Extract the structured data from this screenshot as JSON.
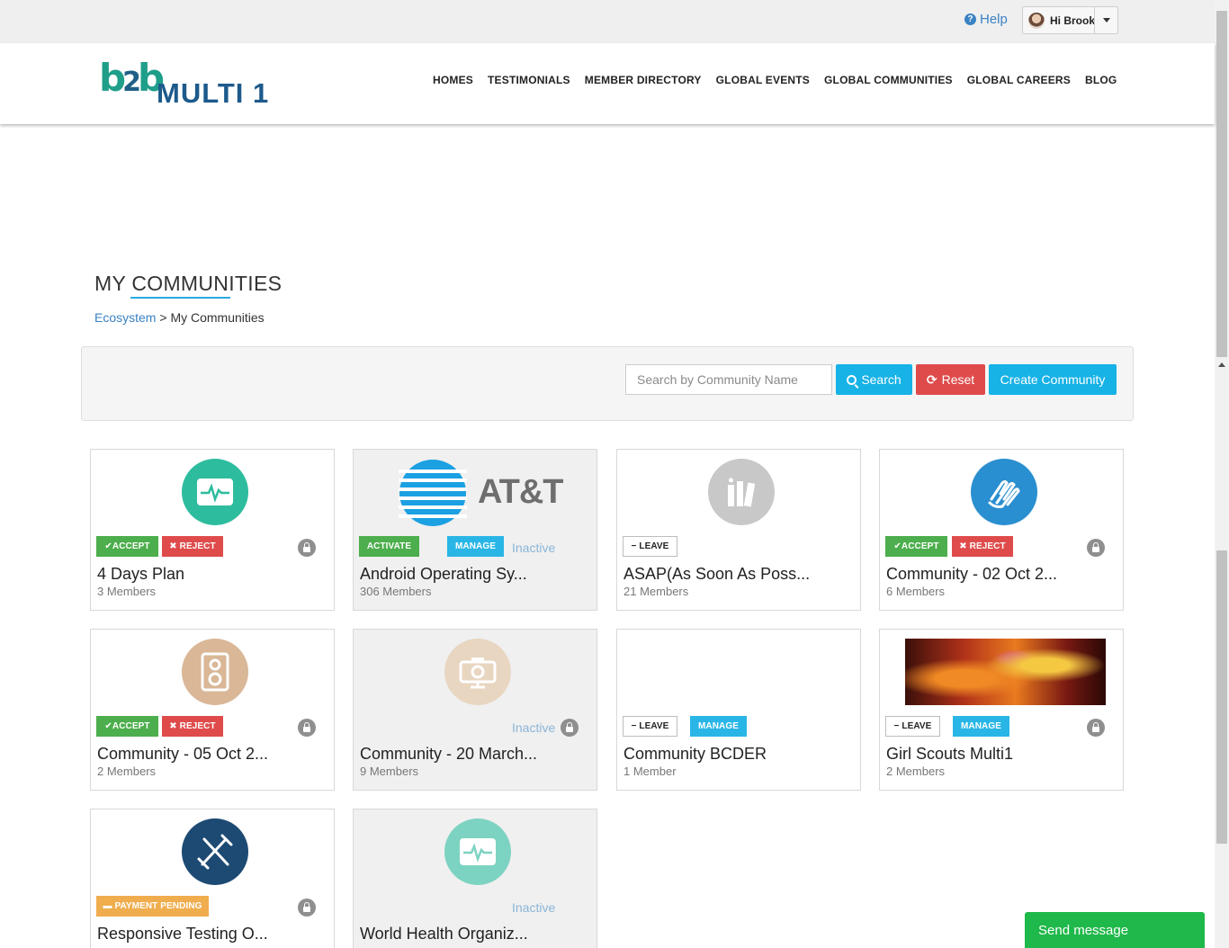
{
  "topbar": {
    "help_label": "Help",
    "user_greeting": "Hi Brook"
  },
  "header": {
    "logo_mark": "b2b",
    "logo_text": "MULTI 1",
    "nav": [
      "HOMES",
      "TESTIMONIALS",
      "MEMBER DIRECTORY",
      "GLOBAL EVENTS",
      "GLOBAL COMMUNITIES",
      "GLOBAL CAREERS",
      "BLOG"
    ]
  },
  "page": {
    "title": "MY COMMUNITIES",
    "breadcrumb_root": "Ecosystem",
    "breadcrumb_sep": ">",
    "breadcrumb_current": "My Communities"
  },
  "search": {
    "placeholder": "Search by Community Name",
    "search_label": "Search",
    "reset_label": "Reset",
    "create_label": "Create Community"
  },
  "labels": {
    "accept": "ACCEPT",
    "reject": "REJECT",
    "activate": "ACTIVATE",
    "manage": "MANAGE",
    "leave": "LEAVE",
    "payment": "PAYMENT PENDING",
    "inactive": "Inactive"
  },
  "cards": [
    {
      "name": "4 Days Plan",
      "members": "3 Members",
      "icon": "health-monitor-icon",
      "color": "#2dbd9e"
    },
    {
      "name": "Android Operating Sy...",
      "members": "306 Members",
      "icon": "att-logo",
      "logo_text": "AT&T"
    },
    {
      "name": "ASAP(As Soon As Poss...",
      "members": "21 Members",
      "icon": "books-icon",
      "color": "#c8c8c8"
    },
    {
      "name": "Community - 02 Oct 2...",
      "members": "6 Members",
      "icon": "praying-hands-icon",
      "color": "#2a8fd0"
    },
    {
      "name": "Community - 05 Oct 2...",
      "members": "2 Members",
      "icon": "speaker-icon",
      "color": "#d9b797"
    },
    {
      "name": "Community - 20 March...",
      "members": "9 Members",
      "icon": "camera-icon",
      "color": "#e8d6c0"
    },
    {
      "name": "Community BCDER",
      "members": "1 Member",
      "icon": ""
    },
    {
      "name": "Girl Scouts Multi1",
      "members": "2 Members",
      "icon": "flower-photo"
    },
    {
      "name": "Responsive Testing O...",
      "members": "",
      "icon": "pen-pencil-icon",
      "color": "#1d4a73"
    },
    {
      "name": "World Health Organiz...",
      "members": "",
      "icon": "health-monitor-icon",
      "color": "#7dd3c1"
    }
  ],
  "chat": {
    "send_label": "Send message"
  }
}
